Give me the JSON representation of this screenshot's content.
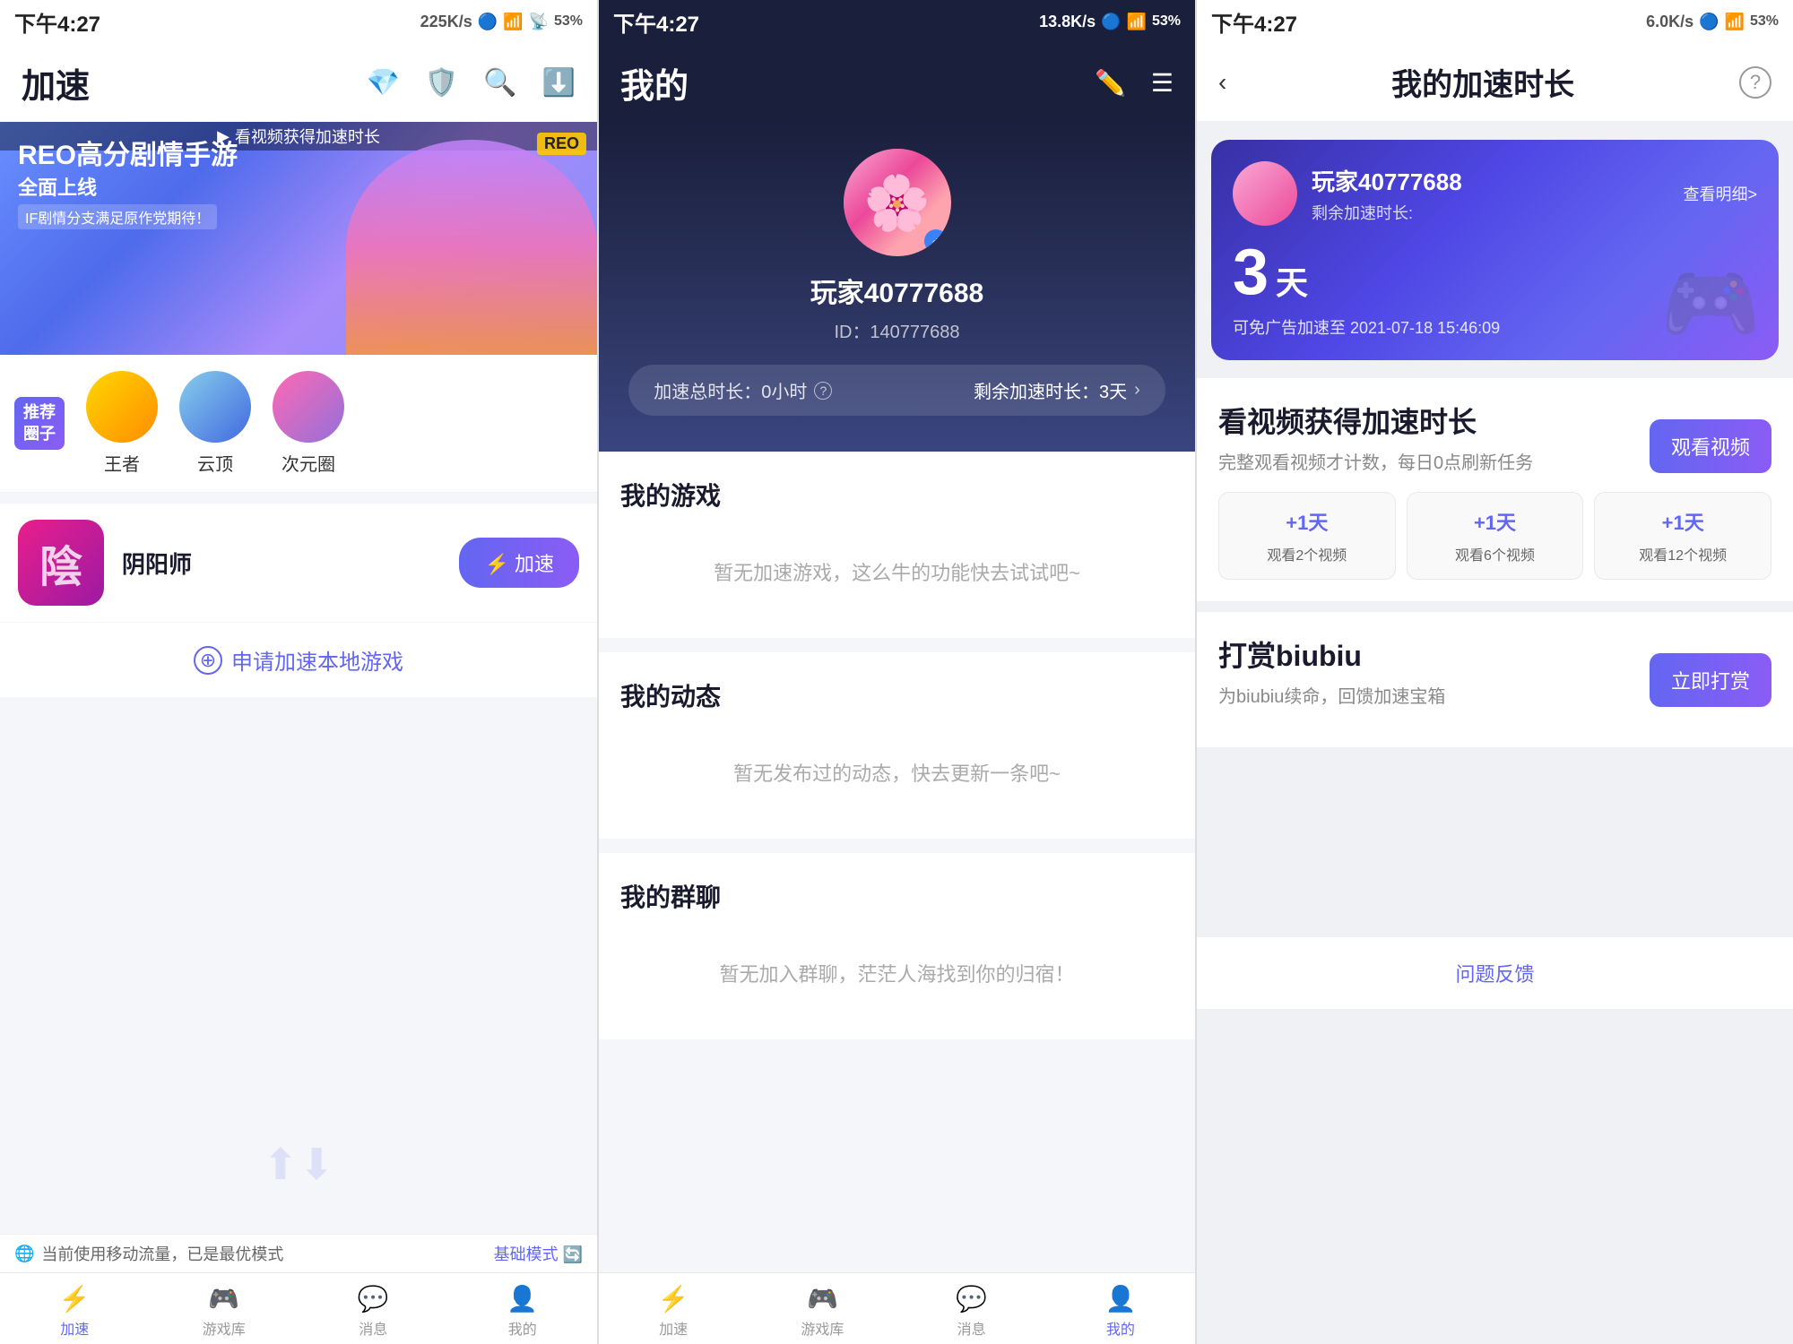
{
  "panel1": {
    "statusBar": {
      "time": "下午4:27",
      "network": "225K/s",
      "battery": "53%",
      "icons": "🔵📶🔋"
    },
    "header": {
      "title": "加速",
      "icons": [
        "diamond",
        "shield",
        "search",
        "download"
      ]
    },
    "promoBanner": {
      "topText": "看视频获得加速时长",
      "badge": "REO",
      "mainTitle": "REO高分剧情手游",
      "subTitle": "全面上线",
      "tag": "IF剧情分支满足原作党期待！"
    },
    "recommend": {
      "label1": "推荐",
      "label2": "圈子",
      "circles": [
        {
          "name": "王者"
        },
        {
          "name": "云顶"
        },
        {
          "name": "次元圈"
        }
      ]
    },
    "gameItem": {
      "name": "阴阳师",
      "boostBtn": "⚡ 加速"
    },
    "applyLocal": {
      "text": "申请加速本地游戏"
    },
    "statusBottom": {
      "text": "当前使用移动流量，已是最优模式",
      "modeText": "基础模式"
    },
    "bottomNav": [
      {
        "label": "加速",
        "active": true
      },
      {
        "label": "游戏库",
        "active": false
      },
      {
        "label": "消息",
        "active": false
      },
      {
        "label": "我的",
        "active": false
      }
    ]
  },
  "panel2": {
    "statusBar": {
      "time": "下午4:27",
      "network": "13.8K/s",
      "battery": "53%"
    },
    "header": {
      "title": "我的",
      "editIcon": "✏️",
      "menuIcon": "☰"
    },
    "profile": {
      "name": "玩家40777688",
      "id": "ID：140777688",
      "totalTime": "加速总时长：0小时",
      "remainTime": "剩余加速时长：3天"
    },
    "sections": [
      {
        "title": "我的游戏",
        "emptyText": "暂无加速游戏，这么牛的功能快去试试吧~"
      },
      {
        "title": "我的动态",
        "emptyText": "暂无发布过的动态，快去更新一条吧~"
      },
      {
        "title": "我的群聊",
        "emptyText": "暂无加入群聊，茫茫人海找到你的归宿！"
      }
    ],
    "bottomNav": [
      {
        "label": "加速",
        "active": false
      },
      {
        "label": "游戏库",
        "active": false
      },
      {
        "label": "消息",
        "active": false
      },
      {
        "label": "我的",
        "active": true
      }
    ]
  },
  "panel3": {
    "statusBar": {
      "time": "下午4:27",
      "network": "6.0K/s",
      "battery": "53%"
    },
    "header": {
      "backIcon": "‹",
      "title": "我的加速时长",
      "questionIcon": "?"
    },
    "profileCard": {
      "name": "玩家40777688",
      "remainLabel": "剩余加速时长:",
      "days": "3",
      "daysUnit": "天",
      "freeAdText": "可免广告加速至 2021-07-18 15:46:09",
      "viewDetail": "查看明细>"
    },
    "videoSection": {
      "title": "看视频获得加速时长",
      "subtitle": "完整观看视频才计数，每日0点刷新任务",
      "watchBtn": "观看视频",
      "rewards": [
        {
          "plus": "+1天",
          "action": "观看2个视频"
        },
        {
          "plus": "+1天",
          "action": "观看6个视频"
        },
        {
          "plus": "+1天",
          "action": "观看12个视频"
        }
      ]
    },
    "tipSection": {
      "title": "打赏biubiu",
      "subtitle": "为biubiu续命，回馈加速宝箱",
      "tipBtn": "立即打赏"
    },
    "feedbackLink": "问题反馈"
  }
}
